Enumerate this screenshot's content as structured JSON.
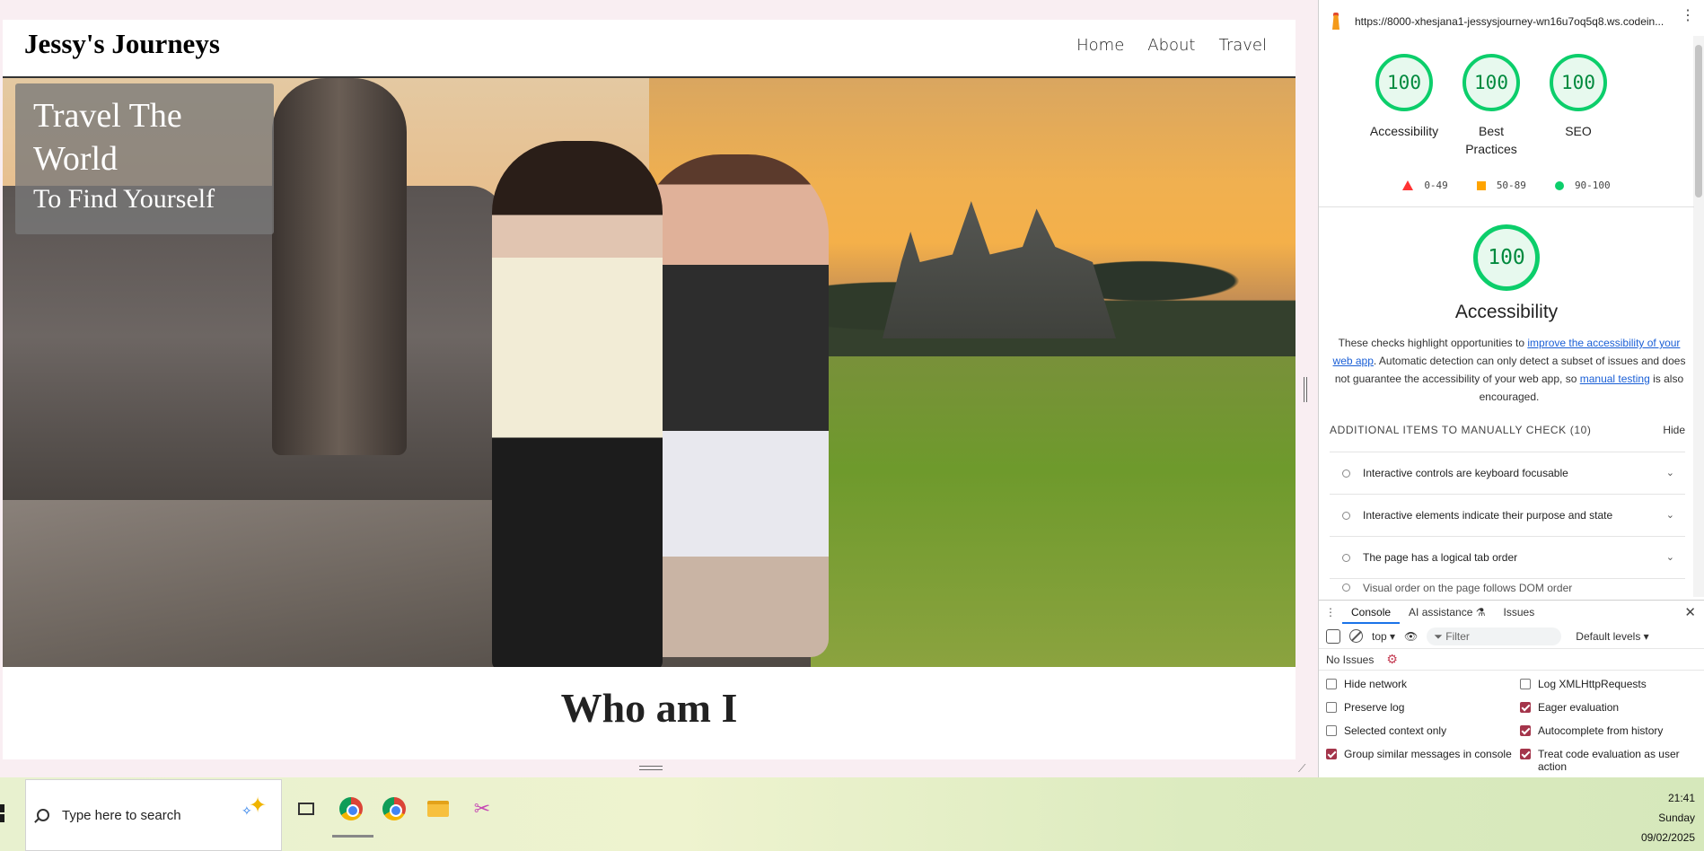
{
  "site": {
    "brand": "Jessy's Journeys",
    "nav": [
      "Home",
      "About",
      "Travel"
    ],
    "hero_title": "Travel The World",
    "hero_subtitle": "To Find Yourself",
    "section_heading": "Who am I"
  },
  "devtools": {
    "url": "https://8000-xhesjana1-jessysjourney-wn16u7oq5q8.ws.codein...",
    "scores": [
      {
        "label": "Accessibility",
        "value": "100"
      },
      {
        "label": "Best Practices",
        "value": "100"
      },
      {
        "label": "SEO",
        "value": "100"
      }
    ],
    "legend": [
      "0-49",
      "50-89",
      "90-100"
    ],
    "category": {
      "score": "100",
      "title": "Accessibility",
      "desc_before": "These checks highlight opportunities to ",
      "desc_link1": "improve the accessibility of your web app",
      "desc_middle": ". Automatic detection can only detect a subset of issues and does not guarantee the accessibility of your web app, so ",
      "desc_link2": "manual testing",
      "desc_after": " is also encouraged."
    },
    "manual_header": "ADDITIONAL ITEMS TO MANUALLY CHECK",
    "manual_count": "(10)",
    "manual_hide": "Hide",
    "audits": [
      "Interactive controls are keyboard focusable",
      "Interactive elements indicate their purpose and state",
      "The page has a logical tab order",
      "Visual order on the page follows DOM order"
    ],
    "drawer": {
      "tabs": [
        "Console",
        "AI assistance",
        "Issues"
      ],
      "context": "top ▾",
      "filter_placeholder": "Filter",
      "levels": "Default levels ▾",
      "no_issues": "No Issues",
      "settings": [
        {
          "label": "Hide network",
          "checked": false
        },
        {
          "label": "Log XMLHttpRequests",
          "checked": false
        },
        {
          "label": "Preserve log",
          "checked": false
        },
        {
          "label": "Eager evaluation",
          "checked": true
        },
        {
          "label": "Selected context only",
          "checked": false
        },
        {
          "label": "Autocomplete from history",
          "checked": true
        },
        {
          "label": "Group similar messages in console",
          "checked": true
        },
        {
          "label": "Treat code evaluation as user action",
          "checked": true
        }
      ]
    }
  },
  "taskbar": {
    "search_placeholder": "Type here to search",
    "time": "21:41",
    "day": "Sunday",
    "date": "09/02/2025"
  }
}
